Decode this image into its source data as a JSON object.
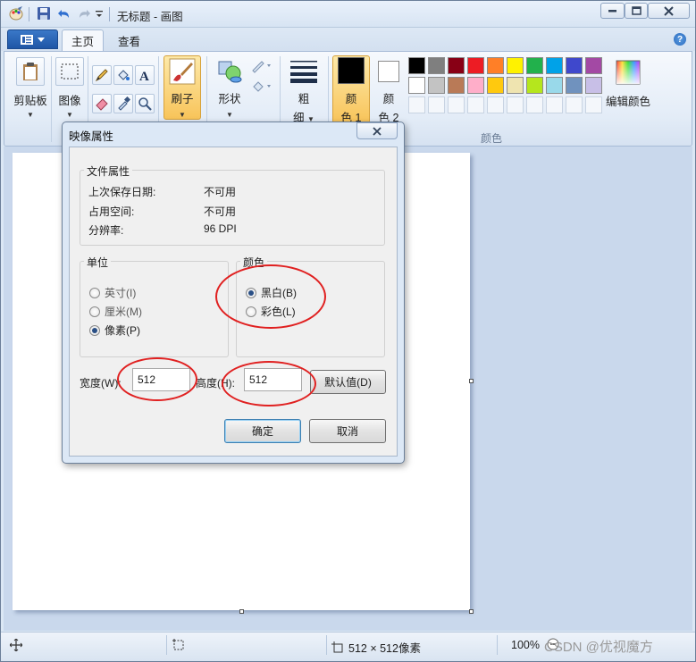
{
  "window": {
    "title": "无标题 - 画图"
  },
  "tabs": [
    {
      "label": "主页",
      "active": true
    },
    {
      "label": "查看",
      "active": false
    }
  ],
  "ribbon": {
    "clipboard": {
      "label": "剪贴板"
    },
    "image": {
      "label": "图像"
    },
    "brushes": {
      "label": "刷子"
    },
    "shapes": {
      "label": "形状"
    },
    "size": {
      "line1": "粗",
      "line2": "细"
    },
    "color1": {
      "line1": "颜",
      "line2": "色 1",
      "value": "#000000"
    },
    "color2": {
      "line1": "颜",
      "line2": "色 2",
      "value": "#ffffff"
    },
    "edit_colors": {
      "label": "编辑颜色"
    },
    "colors_group_label": "颜色",
    "palette_row1": [
      "#000000",
      "#7f7f7f",
      "#880015",
      "#ed1c24",
      "#ff7f27",
      "#fff200",
      "#22b14c",
      "#00a2e8",
      "#3f48cc",
      "#a349a4"
    ],
    "palette_row2": [
      "#ffffff",
      "#c3c3c3",
      "#b97a57",
      "#ffaec9",
      "#ffc90e",
      "#efe4b0",
      "#b5e61d",
      "#99d9ea",
      "#7092be",
      "#c8bfe7"
    ]
  },
  "dialog": {
    "title": "映像属性",
    "file_props": {
      "legend": "文件属性",
      "rows": [
        {
          "label": "上次保存日期:",
          "value": "不可用"
        },
        {
          "label": "占用空间:",
          "value": "不可用"
        },
        {
          "label": "分辨率:",
          "value": "96 DPI"
        }
      ]
    },
    "units": {
      "legend": "单位",
      "options": [
        {
          "label": "英寸(I)",
          "checked": false
        },
        {
          "label": "厘米(M)",
          "checked": false
        },
        {
          "label": "像素(P)",
          "checked": true
        }
      ]
    },
    "colors": {
      "legend": "颜色",
      "options": [
        {
          "label": "黑白(B)",
          "checked": true
        },
        {
          "label": "彩色(L)",
          "checked": false
        }
      ]
    },
    "width_label": "宽度(W):",
    "width_value": "512",
    "height_label": "高度(H):",
    "height_value": "512",
    "default_button": "默认值(D)",
    "ok_button": "确定",
    "cancel_button": "取消"
  },
  "status": {
    "size": "512 × 512像素",
    "zoom": "100%"
  },
  "watermark": "CSDN @优视魔方"
}
